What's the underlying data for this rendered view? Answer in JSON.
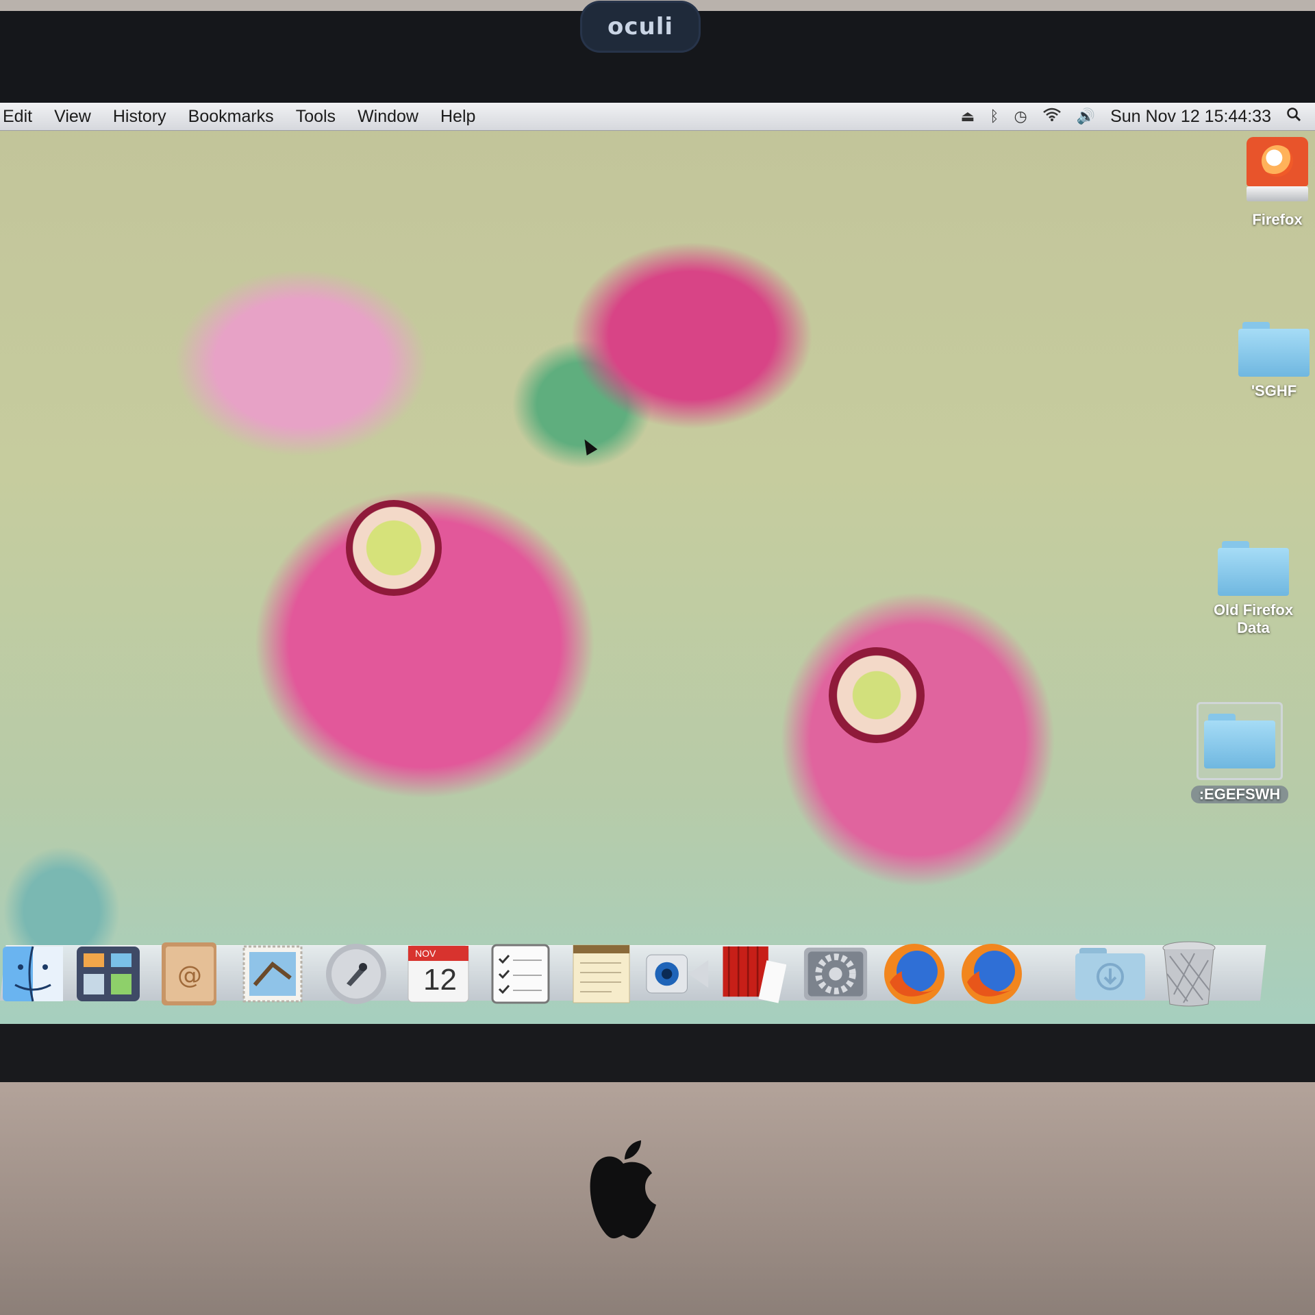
{
  "webcam_brand": "oculi",
  "menubar": {
    "items": [
      "Edit",
      "View",
      "History",
      "Bookmarks",
      "Tools",
      "Window",
      "Help"
    ],
    "status_icons": [
      "eject-icon",
      "bluetooth-icon",
      "time-machine-icon",
      "wifi-icon",
      "volume-icon"
    ],
    "clock": "Sun Nov 12  15:44:33",
    "spotlight_icon": "spotlight-search-icon"
  },
  "desktop_icons": [
    {
      "label": "Firefox",
      "type": "firefox-drive-icon"
    },
    {
      "label": "'SGHF",
      "type": "folder-icon"
    },
    {
      "label": "Old Firefox Data",
      "type": "folder-icon"
    },
    {
      "label": ":EGEFSWH",
      "type": "folder-icon",
      "selected": true
    }
  ],
  "dock": {
    "apps": [
      {
        "name": "Finder",
        "icon": "finder-icon"
      },
      {
        "name": "Mission Control",
        "icon": "mission-control-icon"
      },
      {
        "name": "Contacts",
        "icon": "contacts-icon"
      },
      {
        "name": "Mail",
        "icon": "mail-icon"
      },
      {
        "name": "Launchpad",
        "icon": "launchpad-icon"
      },
      {
        "name": "Calendar",
        "icon": "calendar-icon",
        "month": "NOV",
        "day": "12"
      },
      {
        "name": "Reminders",
        "icon": "reminders-icon"
      },
      {
        "name": "Notes",
        "icon": "notes-icon"
      },
      {
        "name": "FaceTime",
        "icon": "facetime-icon"
      },
      {
        "name": "Photo Booth",
        "icon": "photo-booth-icon"
      },
      {
        "name": "System Preferences",
        "icon": "system-preferences-icon"
      },
      {
        "name": "Firefox",
        "icon": "firefox-icon"
      },
      {
        "name": "Firefox",
        "icon": "firefox-icon"
      },
      {
        "name": "Downloads",
        "icon": "downloads-folder-icon"
      },
      {
        "name": "Trash",
        "icon": "trash-icon"
      }
    ]
  },
  "colors": {
    "menubar": "#e4e6ea",
    "folder": "#8fd0f0",
    "accent_flower": "#e2589a"
  }
}
